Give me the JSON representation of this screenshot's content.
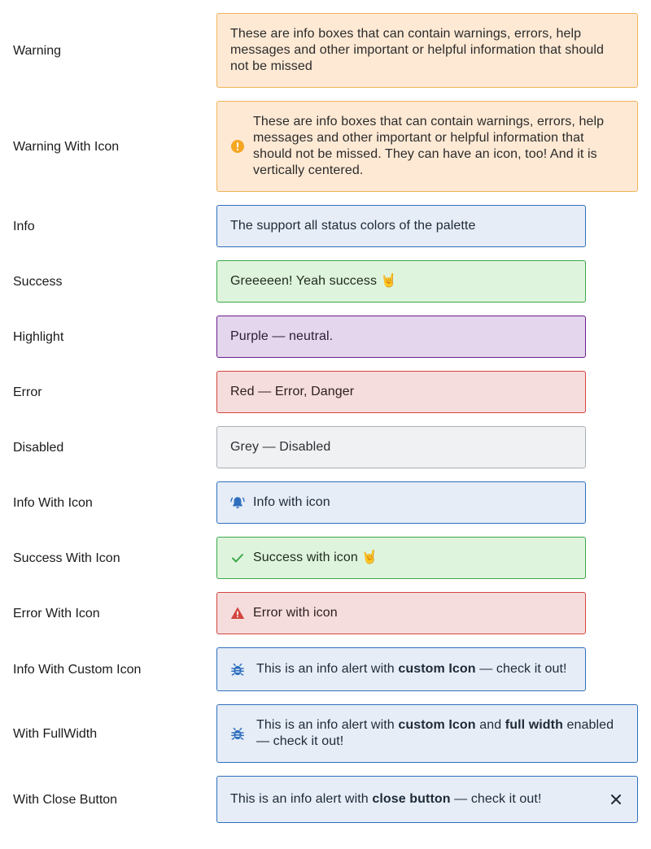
{
  "rows": [
    {
      "label": "Warning",
      "text": "These are info boxes that can contain warnings, errors, help messages and other important or helpful information that should not be missed"
    },
    {
      "label": "Warning With Icon",
      "text": "These are info boxes that can contain warnings, errors, help messages and other important or helpful information that should not be missed. They can have an icon, too! And it is vertically centered.",
      "icon": "exclamation-circle-icon"
    },
    {
      "label": "Info",
      "text": "The support all status colors of the palette"
    },
    {
      "label": "Success",
      "text": "Greeeeen! Yeah success 🤘"
    },
    {
      "label": "Highlight",
      "text": "Purple — neutral."
    },
    {
      "label": "Error",
      "text": "Red — Error, Danger"
    },
    {
      "label": "Disabled",
      "text": "Grey — Disabled"
    },
    {
      "label": "Info With Icon",
      "text": "Info with icon",
      "icon": "bell-ringing-icon"
    },
    {
      "label": "Success With Icon",
      "text": "Success with icon 🤘",
      "icon": "checkmark-icon"
    },
    {
      "label": "Error With Icon",
      "text": "Error with icon",
      "icon": "warning-triangle-icon"
    },
    {
      "label": "Info With Custom Icon",
      "text_pre": "This is an info alert with ",
      "text_bold": "custom Icon",
      "text_post": " — check it out!",
      "icon": "bug-icon"
    },
    {
      "label": "With FullWidth",
      "text_pre": "This is an info alert with ",
      "text_bold": "custom Icon",
      "text_mid": " and ",
      "text_bold2": "full width",
      "text_post": " enabled — check it out!",
      "icon": "bug-icon"
    },
    {
      "label": "With Close Button",
      "text_pre": "This is an info alert with ",
      "text_bold": "close button",
      "text_post": " — check it out!",
      "close_icon": "close-icon"
    }
  ],
  "colors": {
    "warning_icon": "#f5a623",
    "info_icon": "#2f6fbd",
    "success_icon": "#3aa84a",
    "error_icon": "#d2453e",
    "close_icon": "#1e2a38"
  }
}
